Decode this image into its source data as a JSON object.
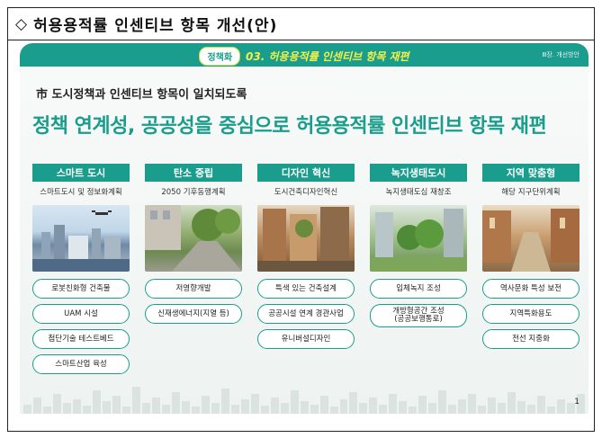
{
  "doc": {
    "diamond": "◇",
    "title": "허용용적률 인센티브 항목 개선(안)"
  },
  "slide": {
    "badge": "정책화",
    "section_num": "03.",
    "section_title": "허용용적률 인센티브 항목 재편",
    "corner_note": "Ⅲ장. 개선방안",
    "subtitle": "市 도시정책과 인센티브 항목이 일치되도록",
    "headline": "정책 연계성, 공공성을 중심으로 허용용적률 인센티브 항목 재편",
    "page_number": "1"
  },
  "columns": [
    {
      "header": "스마트 도시",
      "sub": "스마트도시 및 정보화계획",
      "image": "smart-city-photo",
      "items": [
        "로봇친화형 건축물",
        "UAM 시설",
        "첨단기술 테스트베드",
        "스마트산업 육성"
      ]
    },
    {
      "header": "탄소 중립",
      "sub": "2050 기후동행계획",
      "image": "carbon-neutral-photo",
      "items": [
        "저영향개발",
        "신재생에너지(지열 등)"
      ]
    },
    {
      "header": "디자인 혁신",
      "sub": "도시건축디자인혁신",
      "image": "design-innovation-photo",
      "items": [
        "특색 있는 건축설계",
        "공공시설 연계 경관사업",
        "유니버설디자인"
      ]
    },
    {
      "header": "녹지생태도시",
      "sub": "녹지생태도심 재창조",
      "image": "green-city-photo",
      "items": [
        "입체녹지 조성",
        "개방형공간 조성\n(공공보행통로)"
      ]
    },
    {
      "header": "지역 맞춤형",
      "sub": "해당 지구단위계획",
      "image": "local-custom-photo",
      "items": [
        "역사문화 특성 보전",
        "지역특화용도",
        "전선 지중화"
      ]
    }
  ],
  "colors": {
    "teal": "#1a9d8c",
    "accent_yellow": "#f2f04a"
  }
}
